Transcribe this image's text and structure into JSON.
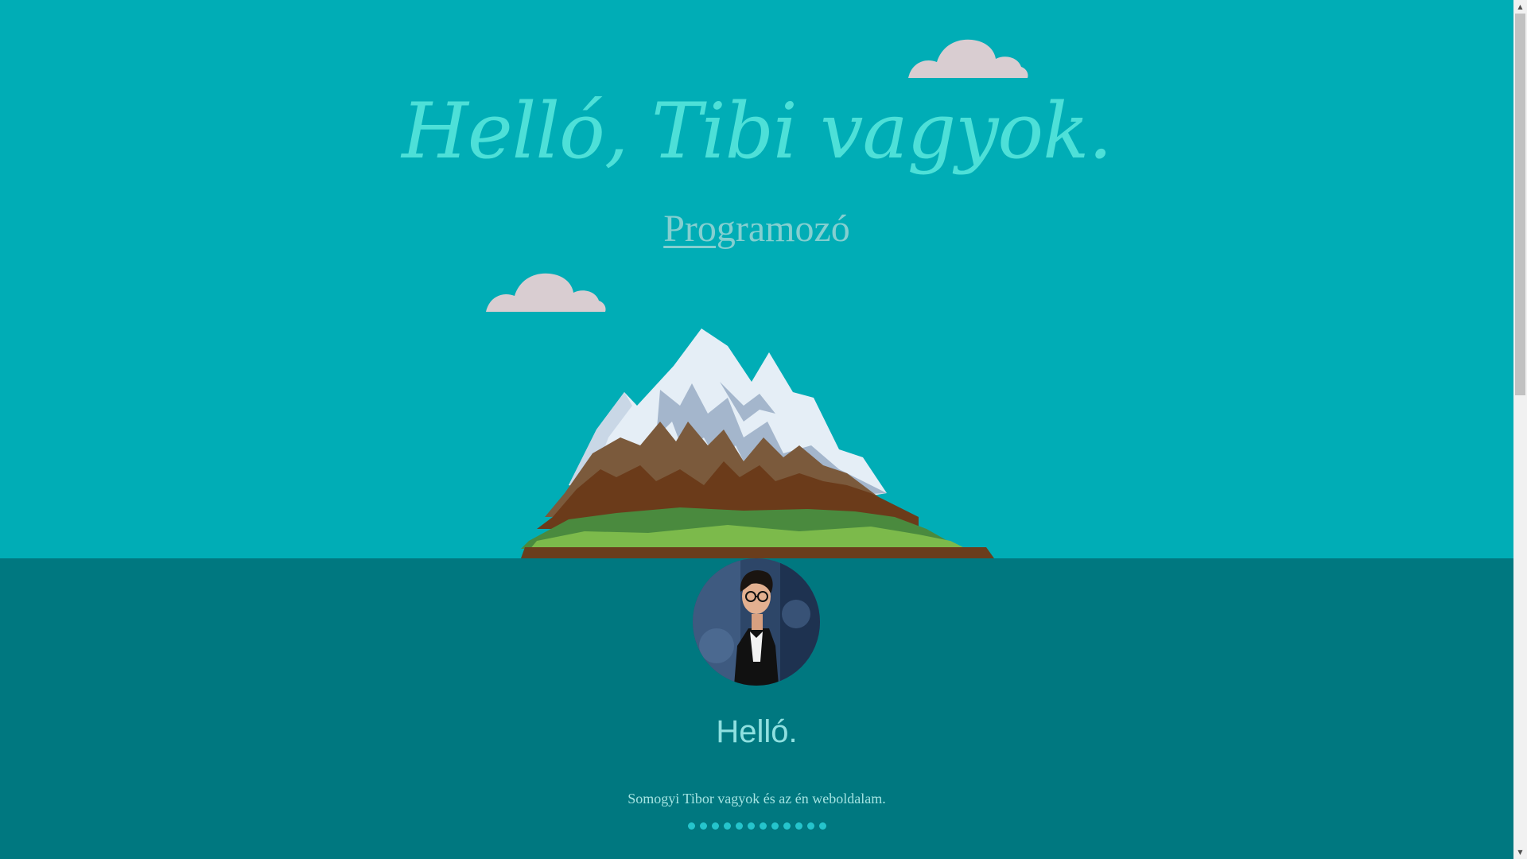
{
  "hero": {
    "title": "Helló, Tibi vagyok.",
    "subtitle_typed": "Prog",
    "subtitle_rest": "ramozó"
  },
  "about": {
    "heading": "Helló.",
    "text": "Somogyi Tibor vagyok és az én weboldalam.",
    "avatar": "profile-photo",
    "dot_count": 12
  },
  "icons": {
    "cloud": "cloud-icon",
    "mountain": "mountain-illustration",
    "scroll_up": "▲",
    "scroll_down": "▼"
  },
  "colors": {
    "hero_bg": "#00adb6",
    "about_bg": "#007880",
    "title": "#4de0d8",
    "cloud": "#d9cdd1",
    "dot": "#25c4cc"
  }
}
